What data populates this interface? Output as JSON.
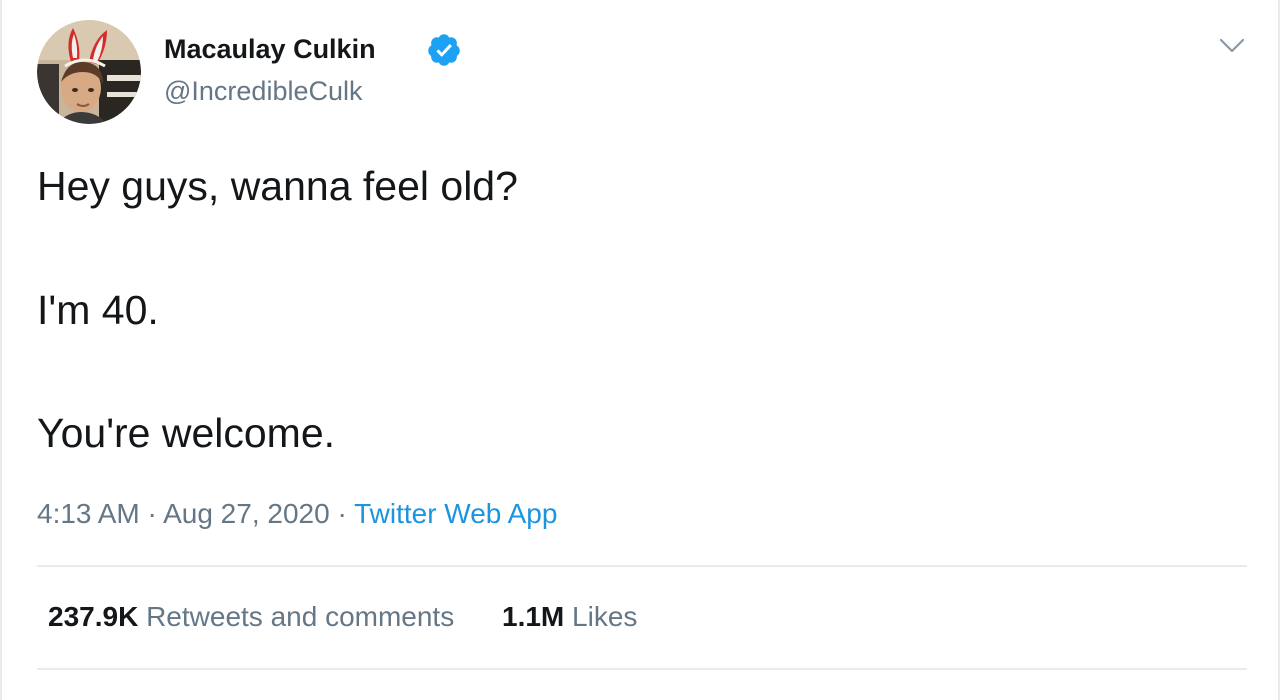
{
  "author": {
    "display_name": "Macaulay Culkin",
    "handle": "@IncredibleCulk",
    "verified_icon": "verified-badge-icon",
    "avatar_icon": "profile-photo-with-bunny-ears"
  },
  "tweet": {
    "lines": [
      "Hey guys, wanna feel old?",
      "I'm 40.",
      "You're welcome."
    ]
  },
  "meta": {
    "time": "4:13 AM",
    "separator": "·",
    "date": "Aug 27, 2020",
    "source": "Twitter Web App"
  },
  "stats": {
    "retweets_count": "237.9K",
    "retweets_label": "Retweets and comments",
    "likes_count": "1.1M",
    "likes_label": "Likes"
  },
  "menu": {
    "icon": "chevron-down-icon"
  },
  "colors": {
    "text": "#14171a",
    "secondary": "#657786",
    "link": "#1b95e0",
    "verified": "#1da1f2",
    "divider": "#e6ecf0"
  }
}
